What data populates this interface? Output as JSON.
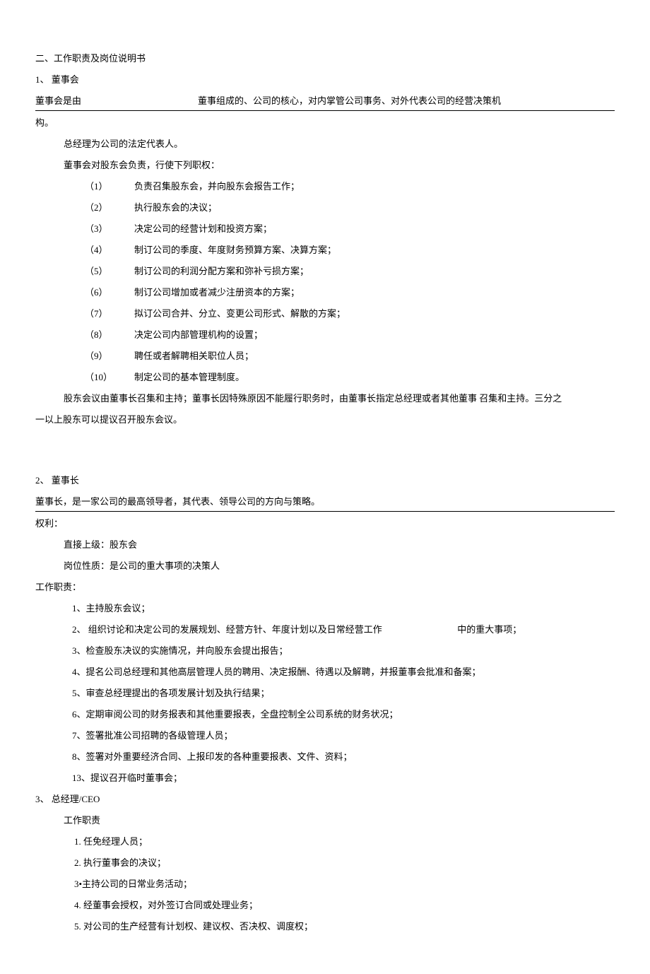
{
  "heading": "二、工作职责及岗位说明书",
  "section1": {
    "num": "1、 董事会",
    "line_pre": "董事会是由",
    "line_post": "董事组成的、公司的核心，对内掌管公司事务、对外代表公司的经营决策机",
    "line_after": "构。",
    "p1": "总经理为公司的法定代表人。",
    "p2": "董事会对股东会负责，行使下列职权：",
    "items": [
      {
        "n": "（1）",
        "t": "负责召集股东会，并向股东会报告工作；"
      },
      {
        "n": "（2）",
        "t": "执行股东会的决议；"
      },
      {
        "n": "（3）",
        "t": "决定公司的经营计划和投资方案；"
      },
      {
        "n": "（4）",
        "t": "制订公司的季度、年度财务预算方案、决算方案；"
      },
      {
        "n": "（5）",
        "t": "制订公司的利润分配方案和弥补亏损方案；"
      },
      {
        "n": "（6）",
        "t": "制订公司增加或者减少注册资本的方案；"
      },
      {
        "n": "（7）",
        "t": "拟订公司合并、分立、变更公司形式、解散的方案；"
      },
      {
        "n": "（8）",
        "t": "决定公司内部管理机构的设置；"
      },
      {
        "n": "（9）",
        "t": "聘任或者解聘相关职位人员；"
      },
      {
        "n": "（10）",
        "t": "制定公司的基本管理制度。"
      }
    ],
    "p3_a": "股东会议由董事长召集和主持；董事长因特殊原因不能履行职务时，由董事长指定总经理或者其他董事 召集和主持。三分之",
    "p3_b": "一以上股东可以提议召开股东会议。"
  },
  "section2": {
    "num": "2、 董事长",
    "line_under": "董事长，是一家公司的最高领导者，其代表、领导公司的方向与策略。",
    "rights_label": "权利：",
    "r1": "直接上级：股东会",
    "r2": "岗位性质：是公司的重大事项的决策人",
    "duties_label": "工作职责：",
    "items": [
      "1、主持股东会议；",
      "3、检查股东决议的实施情况，并向股东会提出报告；",
      "4、提名公司总经理和其他高层管理人员的聘用、决定报酬、待遇以及解聘，并报董事会批准和备案；",
      "5、审查总经理提出的各项发展计划及执行结果；",
      "6、定期审阅公司的财务报表和其他重要报表，全盘控制全公司系统的财务状况；",
      "7、签署批准公司招聘的各级管理人员；",
      "8、签署对外重要经济合同、上报印发的各种重要报表、文件、资料；",
      "13、提议召开临时董事会；"
    ],
    "item2_a": "2、 组织讨论和决定公司的发展规划、经营方针、年度计划以及日常经营工作",
    "item2_b": "中的重大事项；"
  },
  "section3": {
    "num": "3、 总经理/CEO",
    "duties_label": "工作职责",
    "items": [
      "1.  任免经理人员；",
      "2.  执行董事会的决议；",
      "3•主持公司的日常业务活动；",
      "4.  经董事会授权，对外签订合同或处理业务；",
      "5.  对公司的生产经营有计划权、建议权、否决权、调度权；"
    ]
  }
}
